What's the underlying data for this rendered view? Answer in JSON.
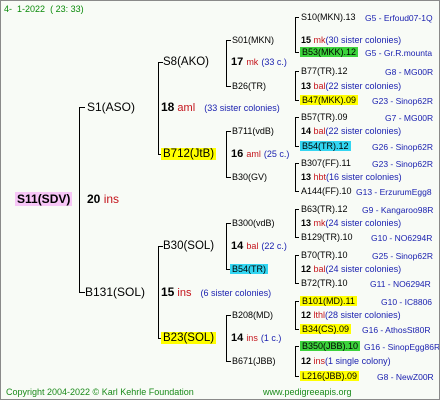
{
  "header": {
    "prefix": "4-",
    "date": "1-2022",
    "time": "( 23: 33)"
  },
  "footer": {
    "copyright": "Copyright 2004-2022 © Karl Kehrle Foundation",
    "site": "www.pedigreeapis.org"
  },
  "queen": {
    "name": "S11(SDV)",
    "year": "20",
    "mark": "ins"
  },
  "gen1": {
    "sire": {
      "name": "S1(ASO)",
      "year": "18",
      "mark": "aml",
      "sisters": "(33 sister colonies)"
    },
    "dam": {
      "name": "B131(SOL)",
      "year": "15",
      "mark": "ins",
      "sisters": "(6 sister colonies)"
    }
  },
  "gen2": {
    "a": {
      "name": "S8(AKO)",
      "year": "17",
      "mark": "mk",
      "sisters": "(33 c.)"
    },
    "b": {
      "name": "B712(JtB)",
      "year": "16",
      "mark": "aml",
      "sisters": "(25 c.)"
    },
    "c": {
      "name": "B30(SOL)",
      "year": "14",
      "mark": "bal",
      "sisters": "(22 c.)"
    },
    "d": {
      "name": "B23(SOL)",
      "year": "14",
      "mark": "ins",
      "sisters": "(1 c.)"
    }
  },
  "gen3": {
    "a": {
      "name": "S01(MKN)",
      "year": "15",
      "mark": "mk",
      "sisters": "(30 sister colonies)"
    },
    "b": {
      "name": "B26(TR)",
      "year": "13",
      "mark": "bal",
      "sisters": "(22 sister colonies)"
    },
    "c": {
      "name": "B711(vdB)",
      "year": "14",
      "mark": "bal",
      "sisters": "(22 sister colonies)"
    },
    "d": {
      "name": "B30(GV)",
      "year": "13",
      "mark": "hbt",
      "sisters": "(16 sister colonies)"
    },
    "e": {
      "name": "B300(vdB)",
      "year": "13",
      "mark": "mk",
      "sisters": "(24 sister colonies)"
    },
    "f": {
      "name": "B54(TR)",
      "year": "12",
      "mark": "bal",
      "sisters": "(24 sister colonies)"
    },
    "g": {
      "name": "B208(MD)",
      "year": "12",
      "mark": "lthl",
      "sisters": "(28 sister colonies)"
    },
    "h": {
      "name": "B671(JBB)",
      "year": "12",
      "mark": "ins",
      "sisters": "(1 single colony)"
    }
  },
  "gen4": [
    {
      "name": "S10(MKN).13",
      "code": "G5 - Erfoud07-1Q"
    },
    {
      "name": "B53(MKK).12",
      "code": "G5 - Gr.R.mounta"
    },
    {
      "name": "B77(TR).12",
      "code": "G8 - MG00R"
    },
    {
      "name": "B47(MKK).09",
      "code": "G23 - Sinop62R"
    },
    {
      "name": "B57(TR).09",
      "code": "G7 - MG00R"
    },
    {
      "name": "B54(TR).12",
      "code": "G26 - Sinop62R"
    },
    {
      "name": "B307(FF).11",
      "code": "G23 - Sinop62R"
    },
    {
      "name": "A144(FF).10",
      "code": "G13 - ErzurumEgg8"
    },
    {
      "name": "B63(TR).12",
      "code": "G9 - Kangaroo98R"
    },
    {
      "name": "B129(TR).10",
      "code": "G10 - NO6294R"
    },
    {
      "name": "B70(TR).10",
      "code": "G25 - Sinop62R"
    },
    {
      "name": "B72(TR).10",
      "code": "G11 - NO6294R"
    },
    {
      "name": "B101(MD).11",
      "code": "G10 - IC8806"
    },
    {
      "name": "B34(CS).09",
      "code": "G16 - AthosSt80R"
    },
    {
      "name": "B350(JBB).10",
      "code": "G16 - SinopEgg86R"
    },
    {
      "name": "L216(JBB).09",
      "code": "G8 - NewZ00R"
    }
  ],
  "colors": {
    "blue": "#1c22b0",
    "red": "#c4141c",
    "green": "#1a8a1a",
    "yellow": "#ffff00",
    "pink": "#f7c6f7",
    "greenHighlight": "#3cd33c",
    "cyan": "#33d6f2"
  }
}
